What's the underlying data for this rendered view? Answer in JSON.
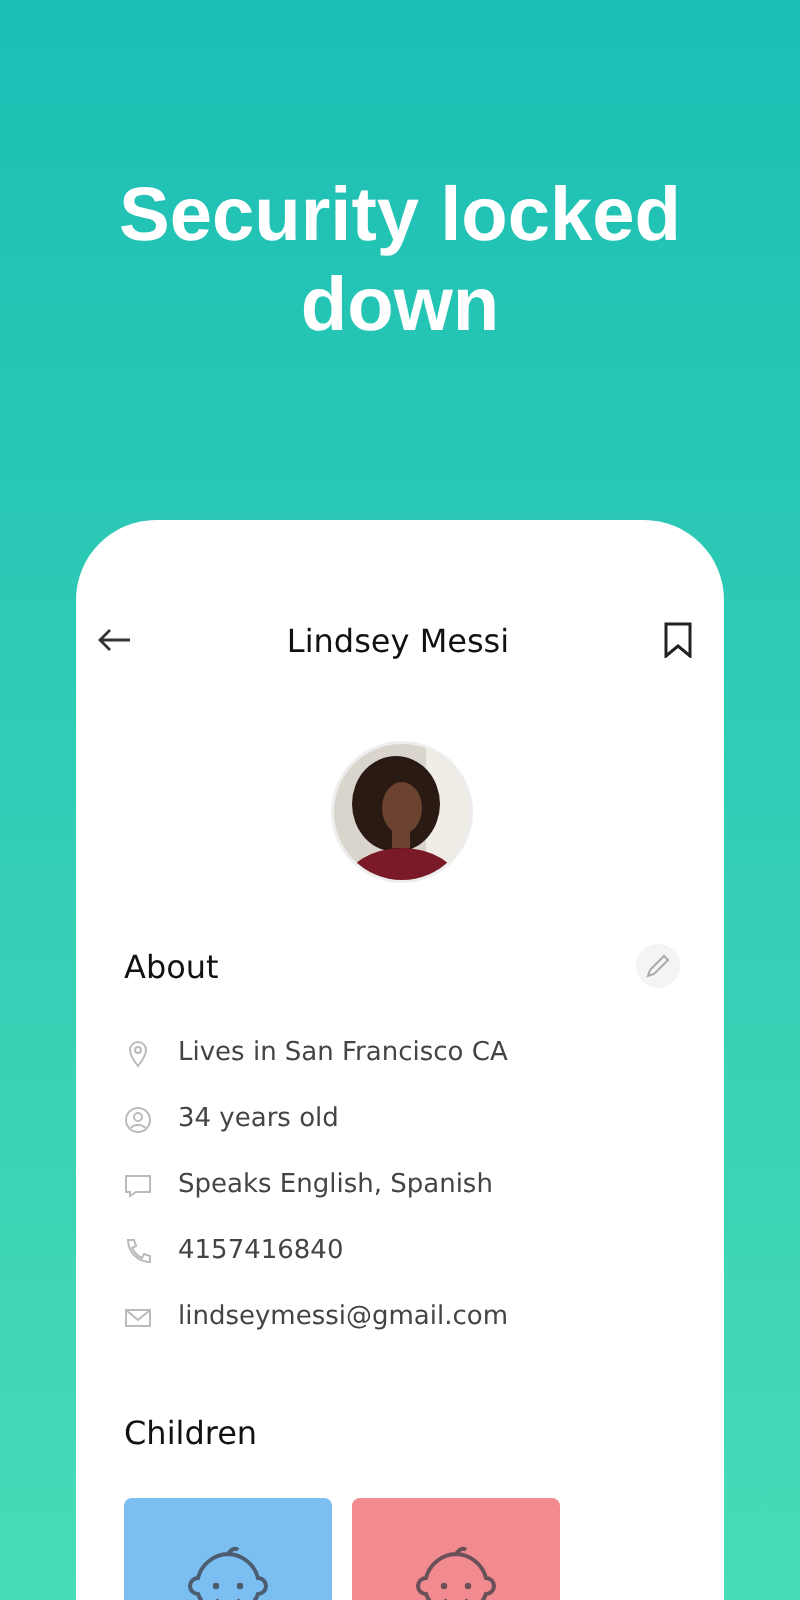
{
  "headline": "Security locked down",
  "profile": {
    "name": "Lindsey Messi"
  },
  "about": {
    "title": "About",
    "details": [
      {
        "kind": "location",
        "text": "Lives in San Francisco CA"
      },
      {
        "kind": "age",
        "text": "34 years old"
      },
      {
        "kind": "language",
        "text": "Speaks English, Spanish"
      },
      {
        "kind": "phone",
        "text": "4157416840"
      },
      {
        "kind": "email",
        "text": "lindseymessi@gmail.com"
      }
    ]
  },
  "children": {
    "title": "Children",
    "items": [
      {
        "color": "#7bbff2"
      },
      {
        "color": "#f28b8f"
      }
    ]
  }
}
